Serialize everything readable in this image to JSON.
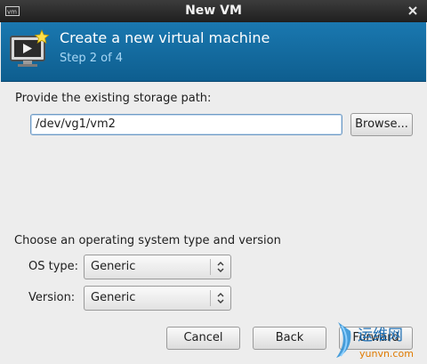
{
  "window": {
    "title": "New VM"
  },
  "header": {
    "title": "Create a new virtual machine",
    "step": "Step 2 of 4"
  },
  "storage": {
    "prompt": "Provide the existing storage path:",
    "path_value": "/dev/vg1/vm2",
    "browse_label": "Browse..."
  },
  "os": {
    "prompt": "Choose an operating system type and version",
    "type_label": "OS type:",
    "type_value": "Generic",
    "version_label": "Version:",
    "version_value": "Generic"
  },
  "buttons": {
    "cancel": "Cancel",
    "back": "Back",
    "forward": "Forward"
  },
  "watermark": {
    "text_cn": "运维网",
    "text_url": "yunvn.com"
  },
  "colors": {
    "header_bg": "#1a78b0",
    "title_bar": "#2a2a2a",
    "step_text": "#a8d8f6"
  }
}
